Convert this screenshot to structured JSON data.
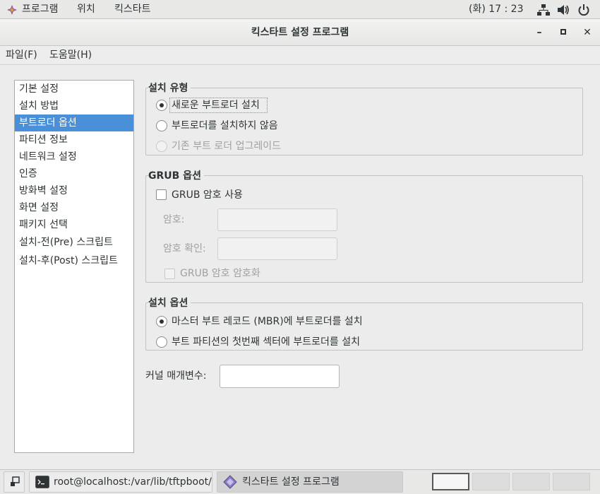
{
  "topbar": {
    "applications": "프로그램",
    "places": "위치",
    "kickstart": "킥스타트",
    "clock": "(화) 17 : 23",
    "icons": [
      "network-icon",
      "volume-icon",
      "power-icon"
    ]
  },
  "window": {
    "title": "킥스타트 설정 프로그램",
    "buttons": [
      "minimize-icon",
      "maximize-icon",
      "close-icon"
    ]
  },
  "menubar": {
    "file": "파일(F)",
    "help": "도움말(H)"
  },
  "sidebar": {
    "items": [
      {
        "label": "기본 설정"
      },
      {
        "label": "설치 방법"
      },
      {
        "label": "부트로더 옵션"
      },
      {
        "label": "파티션 정보"
      },
      {
        "label": "네트워크 설정"
      },
      {
        "label": "인증"
      },
      {
        "label": "방화벽 설정"
      },
      {
        "label": "화면 설정"
      },
      {
        "label": "패키지 선택"
      },
      {
        "label": "설치-전(Pre) 스크립트"
      },
      {
        "label": "설치-후(Post) 스크립트"
      }
    ],
    "selected_index": 2
  },
  "install_type": {
    "title": "설치 유형",
    "new_bootloader": "새로운 부트로더 설치",
    "no_bootloader": "부트로더를 설치하지 않음",
    "upgrade": "기존 부트 로더 업그레이드"
  },
  "grub": {
    "title": "GRUB 옵션",
    "use_password": "GRUB 암호 사용",
    "password_label": "암호:",
    "password_value": "",
    "confirm_label": "암호 확인:",
    "confirm_value": "",
    "encrypt": "GRUB 암호 암호화"
  },
  "install_options": {
    "title": "설치 옵션",
    "mbr": "마스터 부트 레코드 (MBR)에 부트로더를 설치",
    "partition": "부트 파티션의 첫번째 섹터에 부트로더를 설치"
  },
  "kernel": {
    "label": "커널 매개변수:",
    "value": ""
  },
  "taskbar": {
    "terminal_task": "root@localhost:/var/lib/tftpboot/px…",
    "kickstart_task": "킥스타트 설정 프로그램",
    "workspaces": 4,
    "active_workspace": 1
  }
}
